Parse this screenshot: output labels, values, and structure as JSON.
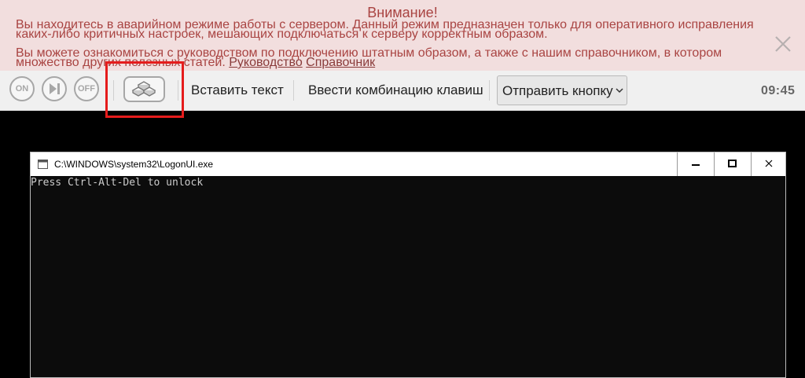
{
  "alert": {
    "title": "Внимание!",
    "line1": "Вы находитесь в аварийном режиме работы с сервером. Данный режим предназначен только для оперативного исправления каких-либо критичных настроек, мешающих подключаться к серверу корректным образом.",
    "line2": "Вы можете ознакомиться с руководством по подключению штатным образом, а также с нашим справочником, в котором множество других полезных статей.",
    "link_guide": "Руководство",
    "link_reference": "Справочник",
    "close_icon": "close-icon"
  },
  "toolbar": {
    "on_label": "ON",
    "off_label": "OFF",
    "reset_icon": "play-pause-icon",
    "gallery_icon": "layers-icon",
    "paste_text_label": "Вставить текст",
    "key_combo_label": "Ввести комбинацию клавиш",
    "send_button_select": "Отправить кнопку",
    "clock": "09:45"
  },
  "console_window": {
    "title": "C:\\WINDOWS\\system32\\LogonUI.exe",
    "output": "Press Ctrl-Alt-Del to unlock"
  },
  "colors": {
    "alert_bg": "#f2dede",
    "alert_text": "#a94442",
    "toolbar_bg": "#f0f0f0",
    "highlight": "#e51c1c",
    "console_bg": "#0c0c0c"
  }
}
